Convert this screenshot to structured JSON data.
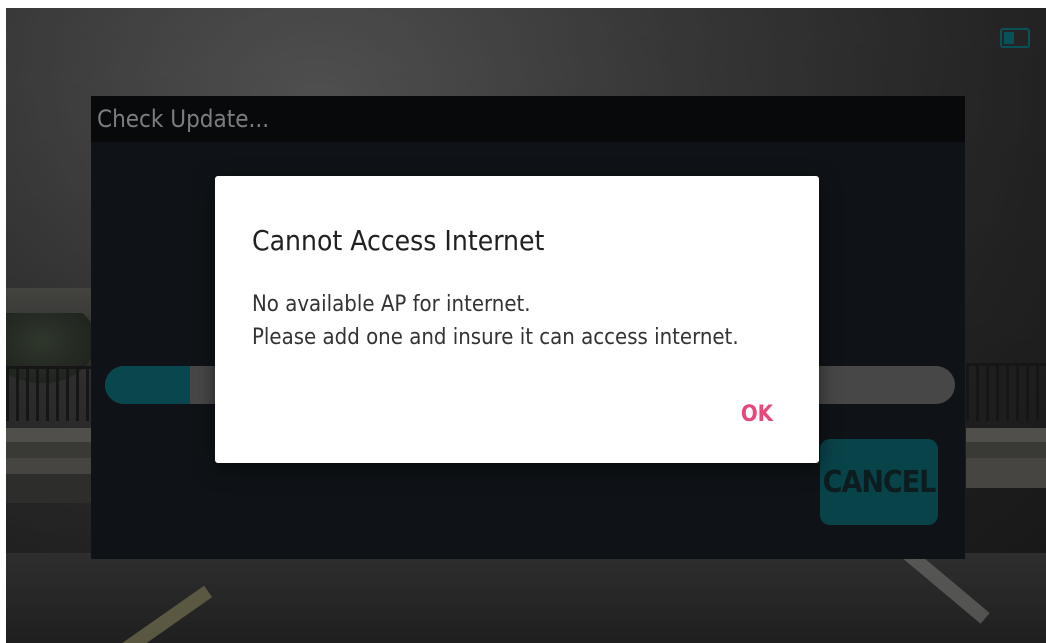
{
  "update_panel": {
    "title": "Check Update...",
    "progress_fraction": 0.1,
    "cancel_label": "CANCEL"
  },
  "dialog": {
    "title": "Cannot Access Internet",
    "message_line1": "No available AP for internet.",
    "message_line2": "Please add one and insure it can access internet.",
    "ok_label": "OK"
  },
  "colors": {
    "accent": "#0d5f68",
    "ok_text": "#e8477a"
  },
  "icons": {
    "status": "battery-icon"
  }
}
